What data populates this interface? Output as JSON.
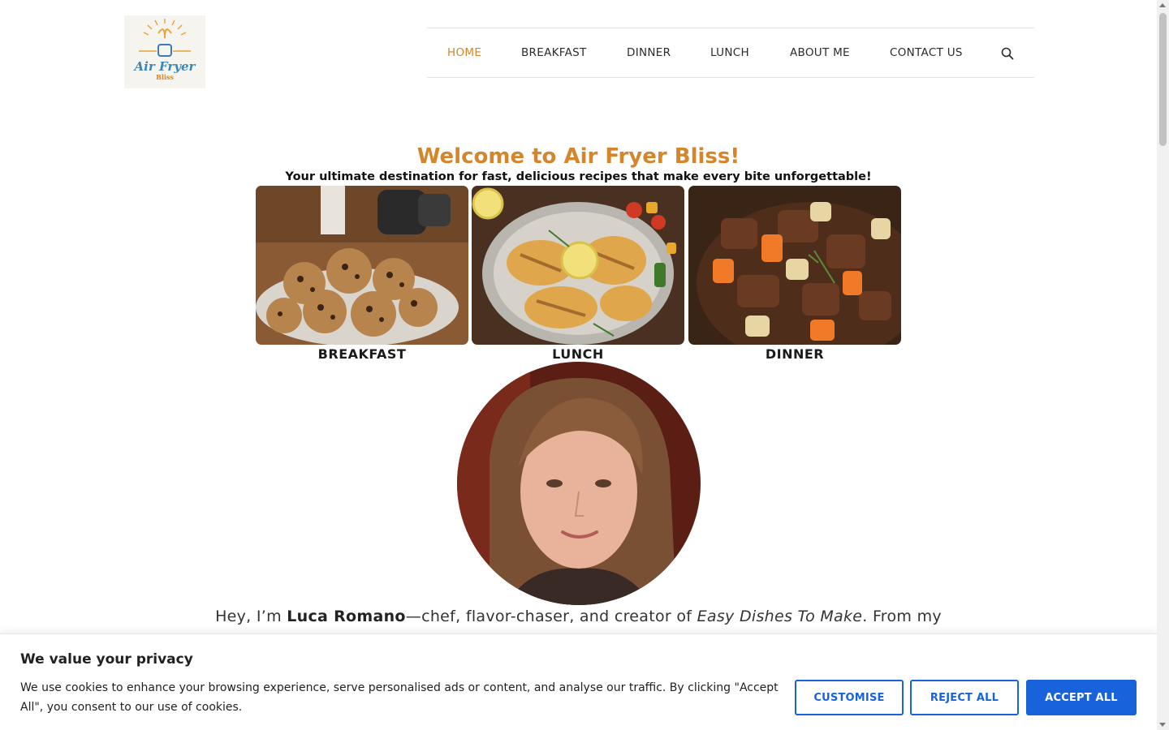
{
  "header": {
    "logo_text": "Air Fryer",
    "logo_subtext": "Bliss",
    "nav": [
      {
        "label": "HOME",
        "active": true
      },
      {
        "label": "BREAKFAST",
        "active": false
      },
      {
        "label": "DINNER",
        "active": false
      },
      {
        "label": "LUNCH",
        "active": false
      },
      {
        "label": "ABOUT ME",
        "active": false
      },
      {
        "label": "CONTACT US",
        "active": false
      }
    ],
    "search_icon": "search-icon"
  },
  "hero": {
    "title": "Welcome to Air Fryer Bliss!",
    "subtitle": "Your ultimate destination for fast, delicious recipes that make every bite unforgettable!",
    "cards": [
      {
        "label": "BREAKFAST",
        "image": "chocolate-chip-cookies"
      },
      {
        "label": "LUNCH",
        "image": "grilled-chicken-lemon"
      },
      {
        "label": "DINNER",
        "image": "beef-stew"
      }
    ]
  },
  "intro": {
    "prefix": "Hey, I’m ",
    "name": "Luca Romano",
    "middle": "—chef, flavor-chaser, and creator of ",
    "site": "Easy Dishes To Make",
    "suffix": ". From my"
  },
  "cookie_banner": {
    "title": "We value your privacy",
    "text": "We use cookies to enhance your browsing experience, serve personalised ads or content, and analyse our traffic. By clicking \"Accept All\", you consent to our use of cookies.",
    "buttons": {
      "customise": "CUSTOMISE",
      "reject": "REJECT ALL",
      "accept": "ACCEPT ALL"
    }
  },
  "colors": {
    "accent": "#d5862a",
    "button_blue": "#1863dc"
  }
}
